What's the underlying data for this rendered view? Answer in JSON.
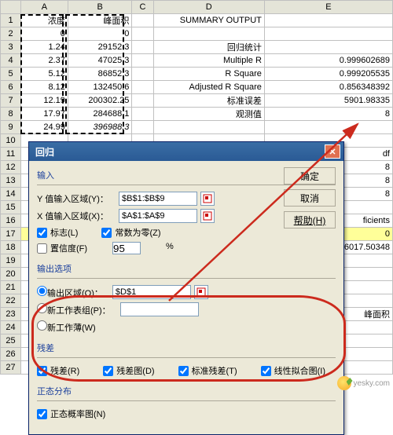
{
  "cols": [
    "A",
    "B",
    "C",
    "D",
    "E"
  ],
  "headers": {
    "A": "浓度",
    "B": "峰面积"
  },
  "dataRows": [
    {
      "A": "0",
      "B": "0"
    },
    {
      "A": "1.24",
      "B": "29152.3"
    },
    {
      "A": "2.37",
      "B": "47025.3"
    },
    {
      "A": "5.12",
      "B": "86852.3"
    },
    {
      "A": "8.12",
      "B": "132450.6"
    },
    {
      "A": "12.19",
      "B": "200302.25"
    },
    {
      "A": "17.97",
      "B": "284688.1"
    },
    {
      "A": "24.99",
      "B": "396988.3"
    }
  ],
  "summary": {
    "title": "SUMMARY OUTPUT",
    "statsHeader": "回归统计",
    "rows": [
      {
        "label": "Multiple R",
        "val": "0.999602689"
      },
      {
        "label": "R Square",
        "val": "0.999205535"
      },
      {
        "label": "Adjusted R Square",
        "val": "0.856348392"
      },
      {
        "label": "标准误差",
        "val": "5901.98335"
      },
      {
        "label": "观测值",
        "val": "8"
      }
    ],
    "dfLabel": "df",
    "eVals": [
      "8",
      "8",
      "8"
    ],
    "ficients": "ficients",
    "row18": "16017.50348",
    "footer": "峰面积"
  },
  "dialog": {
    "title": "回归",
    "btnOk": "确定",
    "btnCancel": "取消",
    "btnHelp": "帮助(H)",
    "grpInput": "输入",
    "yLabel": "Y 值输入区域(Y)：",
    "yVal": "$B$1:$B$9",
    "xLabel": "X 值输入区域(X)：",
    "xVal": "$A$1:$A$9",
    "chkLabels": "标志(L)",
    "chkZero": "常数为零(Z)",
    "chkConf": "置信度(F)",
    "confVal": "95",
    "pct": "%",
    "grpOutput": "输出选项",
    "radOut": "输出区域(O)：",
    "outVal": "$D$1",
    "radNewWs": "新工作表组(P)：",
    "radNewWb": "新工作薄(W)",
    "grpResid": "残差",
    "chkResid": "残差(R)",
    "chkResidPlot": "残差图(D)",
    "chkStdResid": "标准残差(T)",
    "chkLineFit": "线性拟合图(I)",
    "grpNormal": "正态分布",
    "chkNormal": "正态概率图(N)"
  },
  "watermark": "yesky.com"
}
